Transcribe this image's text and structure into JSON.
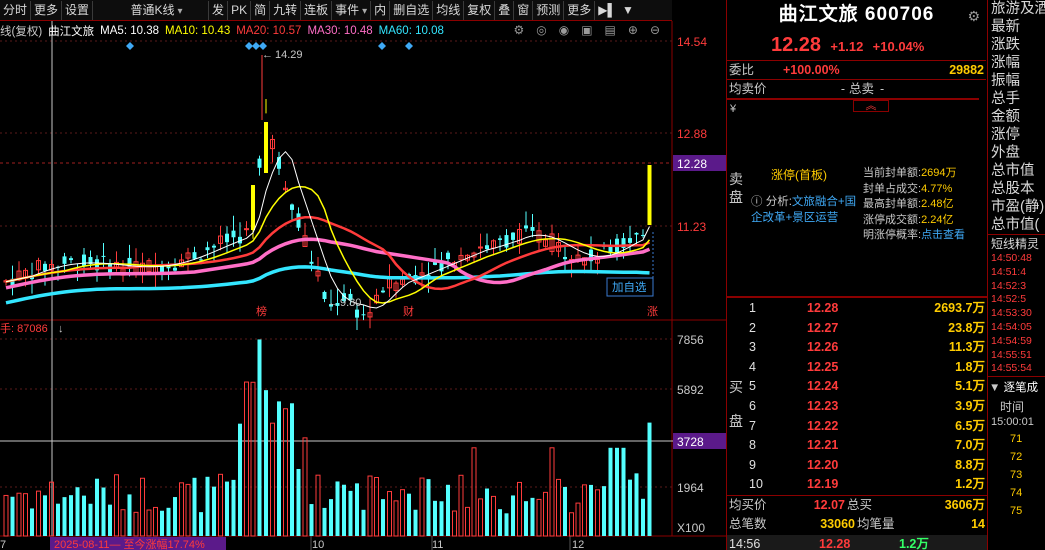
{
  "toolbar": {
    "items": [
      "分时",
      "更多",
      "设置",
      "",
      "普通K线",
      "发",
      "PK",
      "简",
      "九转",
      "连板",
      "事件",
      "内",
      "删自选",
      "均线",
      "复权",
      "叠",
      "窗",
      "预测",
      "更多"
    ]
  },
  "legend": {
    "prefix": "线(复权)",
    "stock": "曲江文旅",
    "ma5": "MA5: 10.38",
    "ma10": "MA10: 10.43",
    "ma20": "MA20: 10.57",
    "ma30": "MA30: 10.48",
    "ma60": "MA60: 10.08"
  },
  "colors": {
    "ma5": "#ffffff",
    "ma10": "#ffff00",
    "ma20": "#ff3b3b",
    "ma30": "#ff6ec7",
    "ma60": "#33e6ff",
    "up": "#ff3b3b",
    "down": "#54ffff",
    "limit": "#ffff00"
  },
  "price_axis": {
    "ticks": [
      "14.54",
      "12.88",
      "12.28",
      "11.23"
    ]
  },
  "volume_axis": {
    "ticks": [
      "7856",
      "5892",
      "3728",
      "1964"
    ],
    "unit": "X100"
  },
  "annotations": {
    "high": "14.29",
    "low": "9.80",
    "add_favorite": "加自选",
    "mark_bang": "榜",
    "mark_cai": "财",
    "mark_zhang": "涨",
    "vol_label": "手: 87086"
  },
  "time_axis": {
    "range_label": "2025-08-11— 至今涨幅17.74%",
    "months": [
      "10",
      "11",
      "12"
    ],
    "left_tick": "7"
  },
  "quote": {
    "name": "曲江文旅 600706",
    "price": "12.28",
    "change": "+1.12",
    "change_pct": "+10.04%",
    "weibi_label": "委比",
    "weibi": "+100.00%",
    "weicha": "29882",
    "avg_sell_label": "均卖价",
    "avg_sell": "-",
    "total_sell_label": "总卖",
    "total_sell": "-",
    "sell_label": "卖盘",
    "yen": "¥",
    "limit_title": "涨停(首板)",
    "analysis_label": "分析:",
    "analysis_text": "文旅融合+国企改革+景区运营",
    "stats": [
      {
        "k": "当前封单额:",
        "v": "2694万"
      },
      {
        "k": "封单占成交:",
        "v": "4.77%"
      },
      {
        "k": "最高封单额:",
        "v": "2.48亿"
      },
      {
        "k": "涨停成交额:",
        "v": "2.24亿"
      },
      {
        "k": "明涨停概率:",
        "v": "点击查看"
      }
    ],
    "buy_label": "买盘",
    "bids": [
      {
        "n": "1",
        "p": "12.28",
        "q": "2693.7万"
      },
      {
        "n": "2",
        "p": "12.27",
        "q": "23.8万"
      },
      {
        "n": "3",
        "p": "12.26",
        "q": "11.3万"
      },
      {
        "n": "4",
        "p": "12.25",
        "q": "1.8万"
      },
      {
        "n": "5",
        "p": "12.24",
        "q": "5.1万"
      },
      {
        "n": "6",
        "p": "12.23",
        "q": "3.9万"
      },
      {
        "n": "7",
        "p": "12.22",
        "q": "6.5万"
      },
      {
        "n": "8",
        "p": "12.21",
        "q": "7.0万"
      },
      {
        "n": "9",
        "p": "12.20",
        "q": "8.8万"
      },
      {
        "n": "10",
        "p": "12.19",
        "q": "1.2万"
      }
    ],
    "avg_buy_label": "均买价",
    "avg_buy": "12.07",
    "total_buy_label": "总买",
    "total_buy": "3606万",
    "total_count_label": "总笔数",
    "total_count": "33060",
    "avg_vol_label": "均笔量",
    "avg_vol": "14",
    "last_time": "14:56",
    "last_price": "12.28",
    "last_vol": "1.2万"
  },
  "far_right": {
    "labels": [
      "旅游及酒",
      "最新",
      "涨跌",
      "涨幅",
      "振幅",
      "总手",
      "金额",
      "涨停",
      "外盘",
      "总市值",
      "总股本",
      "市盈(静)",
      "总市值("
    ],
    "section": "短线精灵",
    "times": [
      "14:50:48",
      "14:51:4",
      "14:52:3",
      "14:52:5",
      "14:53:30",
      "14:54:05",
      "14:54:59",
      "14:55:51",
      "14:55:54"
    ],
    "tab": "逐笔成",
    "col": "时间",
    "t0": "15:00:01",
    "nums": [
      "71",
      "72",
      "73",
      "74",
      "75"
    ]
  },
  "chart_data": {
    "type": "candlestick",
    "price_ticks": [
      14.54,
      12.88,
      12.28,
      11.23
    ],
    "high": 14.29,
    "low": 9.8,
    "last_close": 12.28,
    "ma_last": {
      "MA5": 10.38,
      "MA10": 10.43,
      "MA20": 10.57,
      "MA30": 10.48,
      "MA60": 10.08
    },
    "volume_ticks": [
      7856,
      5892,
      3728,
      1964
    ]
  }
}
